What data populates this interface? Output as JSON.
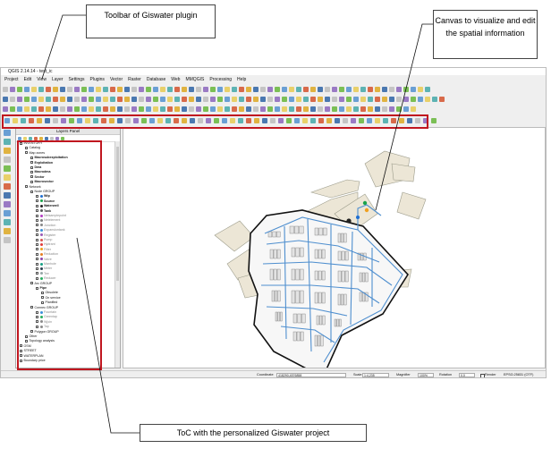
{
  "callouts": {
    "toolbar": "Toolbar of Giswater plugin",
    "canvas": "Canvas to visualize and edit the spatial information",
    "toc": "ToC with the personalized Giswater project"
  },
  "window": {
    "title": "QGIS 2.14.14 - test_ic",
    "menu": [
      "Project",
      "Edit",
      "View",
      "Layer",
      "Settings",
      "Plugins",
      "Vector",
      "Raster",
      "Database",
      "Web",
      "MMQGIS",
      "Processing",
      "Help"
    ]
  },
  "layers_panel": {
    "title": "Layers Panel",
    "items": [
      {
        "label": "INVENTORY",
        "indent": 0,
        "style": "normal",
        "color": ""
      },
      {
        "label": "Catalog",
        "indent": 1,
        "style": "normal",
        "color": ""
      },
      {
        "label": "Map zones",
        "indent": 1,
        "style": "normal",
        "color": ""
      },
      {
        "label": "Macrosubexploitation",
        "indent": 2,
        "style": "bold",
        "color": ""
      },
      {
        "label": "Exploitation",
        "indent": 2,
        "style": "bold",
        "color": ""
      },
      {
        "label": "Dma",
        "indent": 2,
        "style": "bold",
        "color": ""
      },
      {
        "label": "Macrodma",
        "indent": 2,
        "style": "bold",
        "color": ""
      },
      {
        "label": "Sector",
        "indent": 2,
        "style": "bold",
        "color": ""
      },
      {
        "label": "Macrosector",
        "indent": 2,
        "style": "bold",
        "color": ""
      },
      {
        "label": "Network",
        "indent": 1,
        "style": "normal",
        "color": ""
      },
      {
        "label": "Node GROUP",
        "indent": 2,
        "style": "normal",
        "color": ""
      },
      {
        "label": "Wtp",
        "indent": 3,
        "style": "bold",
        "color": "#1f6fd1"
      },
      {
        "label": "Source",
        "indent": 3,
        "style": "bold",
        "color": "#19a34a"
      },
      {
        "label": "Waterwell",
        "indent": 3,
        "style": "bold",
        "color": "#222222"
      },
      {
        "label": "Tank",
        "indent": 3,
        "style": "bold",
        "color": "#555555"
      },
      {
        "label": "Netsamplepoint",
        "indent": 3,
        "style": "grey",
        "color": "#b33cc2"
      },
      {
        "label": "Netelement",
        "indent": 3,
        "style": "grey",
        "color": "#7a7a7a"
      },
      {
        "label": "Junction",
        "indent": 3,
        "style": "grey",
        "color": "#888888"
      },
      {
        "label": "Expansiontank",
        "indent": 3,
        "style": "grey",
        "color": "#3b8fd9"
      },
      {
        "label": "Register",
        "indent": 3,
        "style": "grey",
        "color": "#9b59b6"
      },
      {
        "label": "Pump",
        "indent": 3,
        "style": "grey",
        "color": "#d9534f"
      },
      {
        "label": "Hydrant",
        "indent": 3,
        "style": "grey",
        "color": "#e23b3b"
      },
      {
        "label": "Filter",
        "indent": 3,
        "style": "grey",
        "color": "#f0a020"
      },
      {
        "label": "Reduction",
        "indent": 3,
        "style": "grey",
        "color": "#e67e22"
      },
      {
        "label": "Valve",
        "indent": 3,
        "style": "grey",
        "color": "#8e44ad"
      },
      {
        "label": "Manhole",
        "indent": 3,
        "style": "grey",
        "color": "#16a085"
      },
      {
        "label": "Meter",
        "indent": 3,
        "style": "grey",
        "color": "#2c3e50"
      },
      {
        "label": "Tee",
        "indent": 3,
        "style": "grey",
        "color": "#95a5a6"
      },
      {
        "label": "Reducer",
        "indent": 3,
        "style": "grey",
        "color": "#27ae60"
      },
      {
        "label": "Arc GROUP",
        "indent": 2,
        "style": "normal",
        "color": ""
      },
      {
        "label": "Pipe",
        "indent": 3,
        "style": "bold",
        "color": ""
      },
      {
        "label": "Obsolete",
        "indent": 4,
        "style": "normal",
        "color": ""
      },
      {
        "label": "On service",
        "indent": 4,
        "style": "normal",
        "color": ""
      },
      {
        "label": "Planified",
        "indent": 4,
        "style": "normal",
        "color": ""
      },
      {
        "label": "Connec GROUP",
        "indent": 2,
        "style": "normal",
        "color": ""
      },
      {
        "label": "Fountain",
        "indent": 3,
        "style": "grey",
        "color": "#3b8fd9"
      },
      {
        "label": "Greentap",
        "indent": 3,
        "style": "grey",
        "color": "#27ae60"
      },
      {
        "label": "Wjoin",
        "indent": 3,
        "style": "grey",
        "color": "#8a8a8a"
      },
      {
        "label": "Tap",
        "indent": 3,
        "style": "grey",
        "color": "#8a8a8a"
      },
      {
        "label": "Polygon GROUP",
        "indent": 2,
        "style": "normal",
        "color": ""
      },
      {
        "label": "Other",
        "indent": 1,
        "style": "normal",
        "color": ""
      },
      {
        "label": "Topology analysis",
        "indent": 1,
        "style": "normal",
        "color": ""
      },
      {
        "label": "OSM",
        "indent": 0,
        "style": "normal",
        "color": ""
      },
      {
        "label": "STREET",
        "indent": 0,
        "style": "normal",
        "color": ""
      },
      {
        "label": "WATERPLAN",
        "indent": 0,
        "style": "normal",
        "color": ""
      },
      {
        "label": "Boundary price",
        "indent": 0,
        "style": "normal",
        "color": ""
      }
    ]
  },
  "statusbar": {
    "coordinate_label": "Coordinate",
    "coordinate_value": "418290,4576858",
    "scale_label": "Scale",
    "scale_value": "1:4,235",
    "magnifier_label": "Magnifier",
    "magnifier_value": "100%",
    "rotation_label": "Rotation",
    "rotation_value": "0.0",
    "render_label": "Render",
    "crs_label": "EPSG:25831 (OTF)"
  },
  "colors": {
    "annotation_red": "#c0161f",
    "pipe_blue": "#4f8fcf",
    "building": "#e3e3e3",
    "parcel": "#ece6d6"
  }
}
